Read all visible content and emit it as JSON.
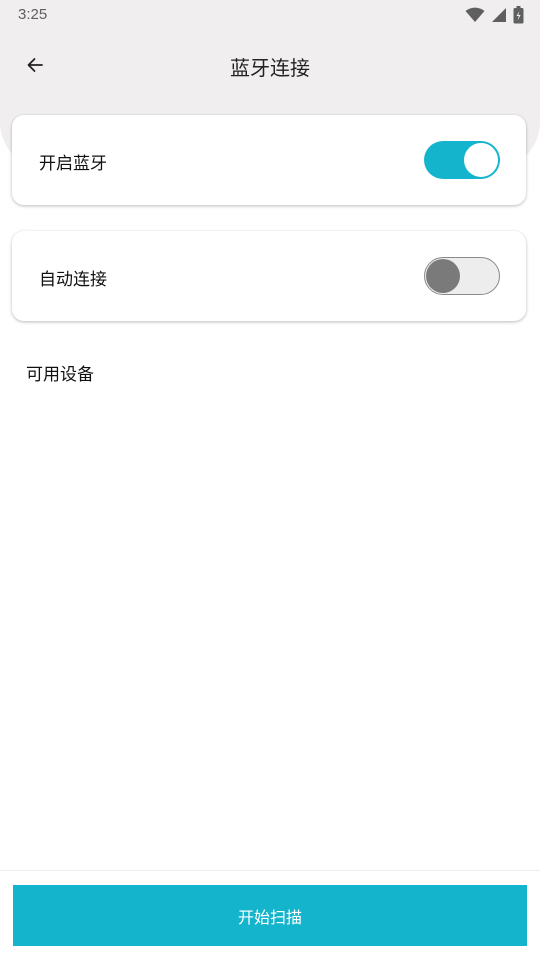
{
  "status_bar": {
    "time": "3:25",
    "icons": [
      "wifi-icon",
      "signal-icon",
      "battery-icon"
    ]
  },
  "app_bar": {
    "back_icon": "arrow-left-icon",
    "title": "蓝牙连接"
  },
  "settings": {
    "bluetooth": {
      "label": "开启蓝牙",
      "enabled": true
    },
    "auto_connect": {
      "label": "自动连接",
      "enabled": false
    }
  },
  "devices": {
    "section_title": "可用设备",
    "items": []
  },
  "actions": {
    "scan_label": "开始扫描"
  },
  "colors": {
    "accent": "#14b4cc",
    "header_bg": "#f0eeef",
    "switch_off_track": "#ededed",
    "switch_off_knob": "#7a7a7a"
  }
}
